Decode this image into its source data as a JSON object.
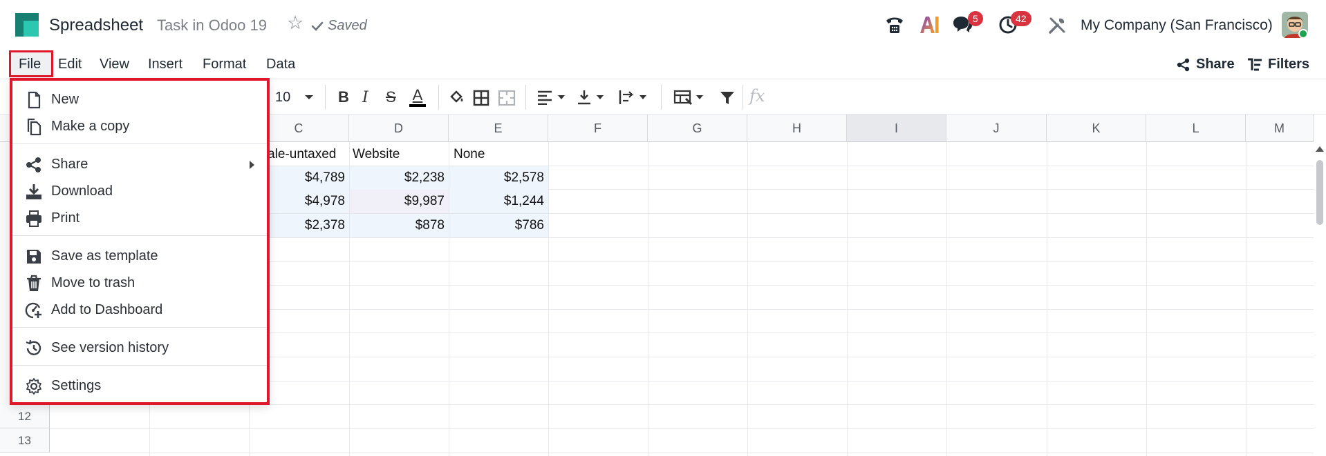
{
  "app": {
    "name": "Spreadsheet",
    "document_title": "Task in Odoo 19",
    "saved_label": "Saved"
  },
  "systray": {
    "messages_count": "5",
    "activities_count": "42",
    "ai_label": "AI",
    "company": "My Company (San Francisco)"
  },
  "menubar": {
    "items": [
      "File",
      "Edit",
      "View",
      "Insert",
      "Format",
      "Data"
    ],
    "share_label": "Share",
    "filters_label": "Filters"
  },
  "toolbar": {
    "font_size": "10",
    "bold": "B",
    "italic": "I",
    "strikethrough": "S",
    "text_color": "A",
    "formula_placeholder": "fx"
  },
  "grid": {
    "columns": [
      "C",
      "D",
      "E",
      "F",
      "G",
      "H",
      "I",
      "J",
      "K",
      "L",
      "M"
    ],
    "rows": [
      "12",
      "13"
    ],
    "cells": {
      "c1": "esale-untaxed",
      "d1": "Website",
      "e1": "None",
      "c2": "$4,789",
      "d2": "$2,238",
      "e2": "$2,578",
      "c3": "$4,978",
      "d3": "$9,987",
      "e3": "$1,244",
      "c4": "$2,378",
      "d4": "$878",
      "e4": "$786"
    }
  },
  "file_menu": {
    "new": "New",
    "make_copy": "Make a copy",
    "share": "Share",
    "download": "Download",
    "print": "Print",
    "save_template": "Save as template",
    "move_trash": "Move to trash",
    "add_dashboard": "Add to Dashboard",
    "version_history": "See version history",
    "settings": "Settings"
  },
  "colors": {
    "highlight_red": "#e0162c",
    "badge_red": "#d9333f",
    "logo_teal": "#1fb6a1"
  }
}
